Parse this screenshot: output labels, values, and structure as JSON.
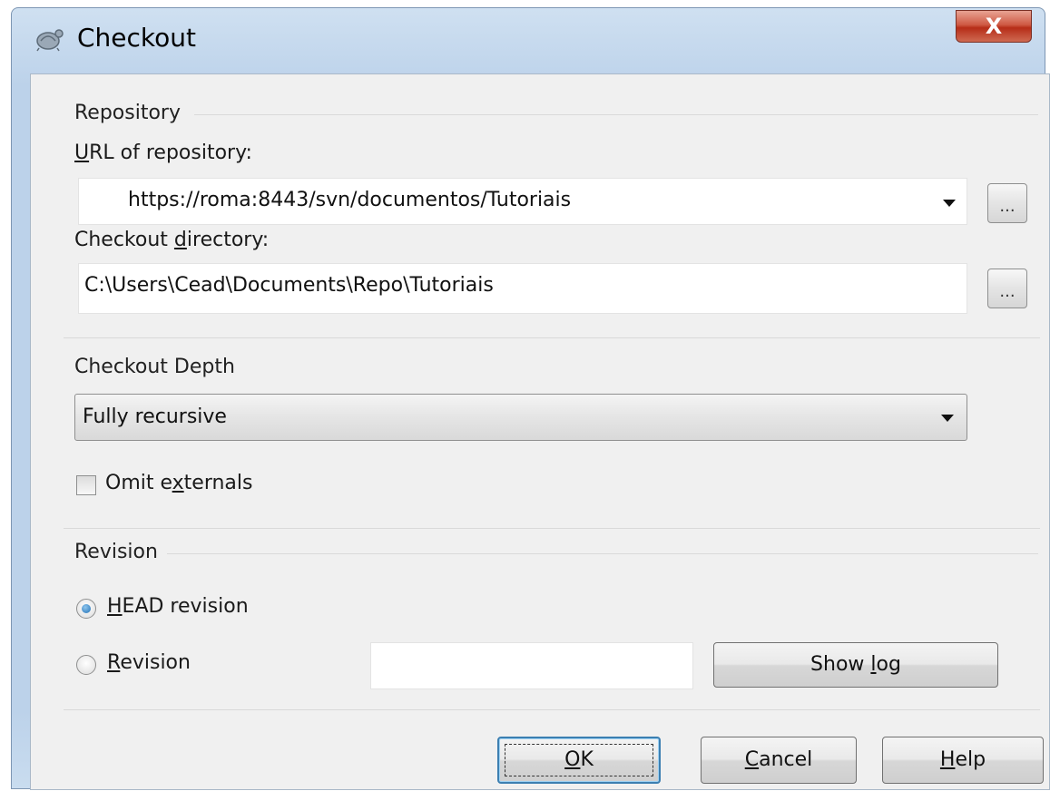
{
  "window": {
    "title": "Checkout",
    "close_label": "X"
  },
  "repository": {
    "group_title": "Repository",
    "url_label": "URL of repository:",
    "url_value": "https://roma:8443/svn/documentos/Tutoriais",
    "browse_label": "...",
    "dir_label": "Checkout directory:",
    "dir_value": "C:\\Users\\Cead\\Documents\\Repo\\Tutoriais",
    "dir_browse_label": "..."
  },
  "depth": {
    "group_title": "Checkout Depth",
    "selected": "Fully recursive",
    "omit_externals_label": "Omit externals",
    "omit_externals_checked": false
  },
  "revision": {
    "group_title": "Revision",
    "head_label": "HEAD revision",
    "head_selected": true,
    "revision_label": "Revision",
    "revision_value": "",
    "show_log_label": "Show log"
  },
  "buttons": {
    "ok": "OK",
    "cancel": "Cancel",
    "help": "Help"
  },
  "colors": {
    "title_bar": "#bcd2ea",
    "close_button": "#c9432c",
    "client_bg": "#f0f0f0",
    "focus_border": "#3c7fb1"
  }
}
